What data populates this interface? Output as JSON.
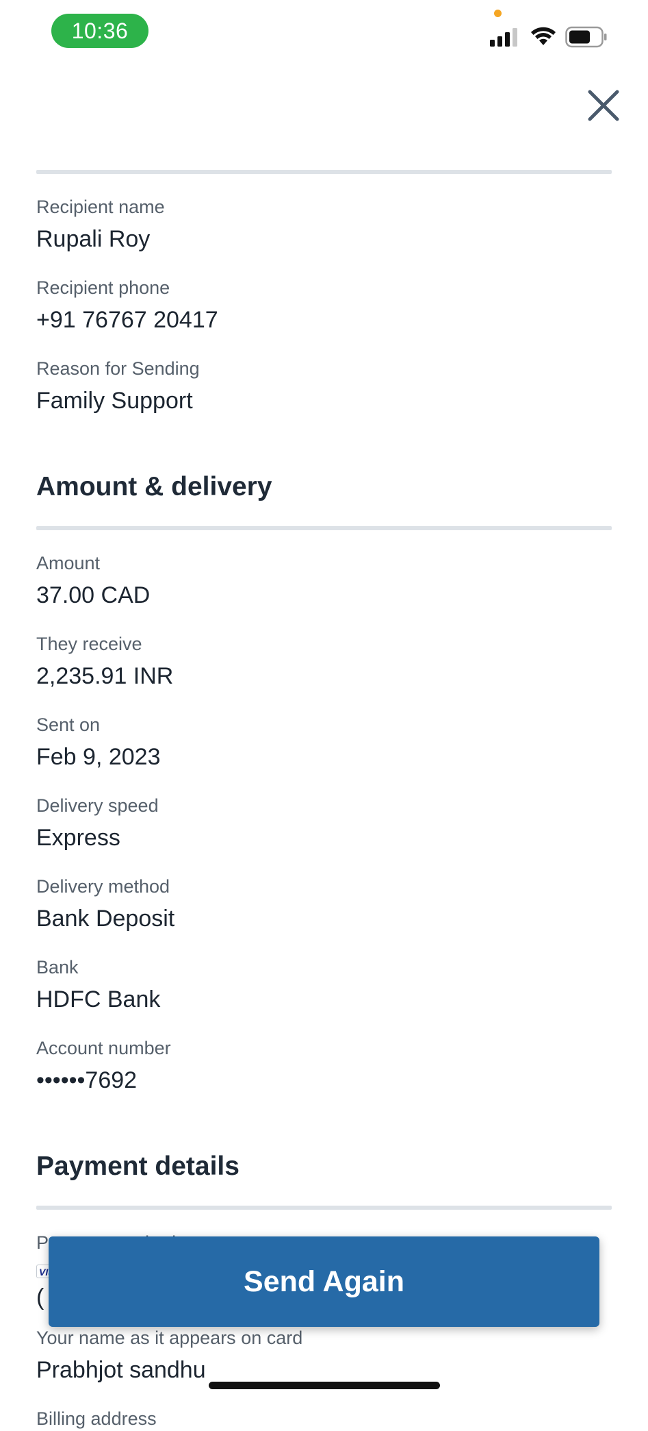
{
  "status_bar": {
    "time": "10:36"
  },
  "icons": {
    "close": "close-icon",
    "signal": "signal-icon",
    "wifi": "wifi-icon",
    "battery": "battery-icon",
    "card": "visa-card-icon"
  },
  "colors": {
    "time_pill": "#2db34a",
    "primary_button": "#266aa7",
    "divider": "#dde2e7",
    "heading_text": "#1f2a37",
    "label_text": "#56606b"
  },
  "recipient": {
    "fields": [
      {
        "label": "Recipient name",
        "value": "Rupali Roy"
      },
      {
        "label": "Recipient phone",
        "value": "+91 76767 20417"
      },
      {
        "label": "Reason for Sending",
        "value": "Family Support"
      }
    ]
  },
  "amount_delivery": {
    "heading": "Amount & delivery",
    "fields": [
      {
        "label": "Amount",
        "value": "37.00 CAD"
      },
      {
        "label": "They receive",
        "value": "2,235.91 INR"
      },
      {
        "label": "Sent on",
        "value": "Feb 9, 2023"
      },
      {
        "label": "Delivery speed",
        "value": "Express"
      },
      {
        "label": "Delivery method",
        "value": "Bank Deposit"
      },
      {
        "label": "Bank",
        "value": "HDFC Bank"
      },
      {
        "label": "Account number",
        "value": "••••••7692"
      }
    ]
  },
  "payment": {
    "heading": "Payment details",
    "method_label": "Payment method",
    "card_brand": "VISA",
    "method_value_partial": "(",
    "name_label": "Your name as it appears on card",
    "name_value": "Prabhjot sandhu",
    "billing_label": "Billing address"
  },
  "actions": {
    "send_again": "Send Again"
  }
}
